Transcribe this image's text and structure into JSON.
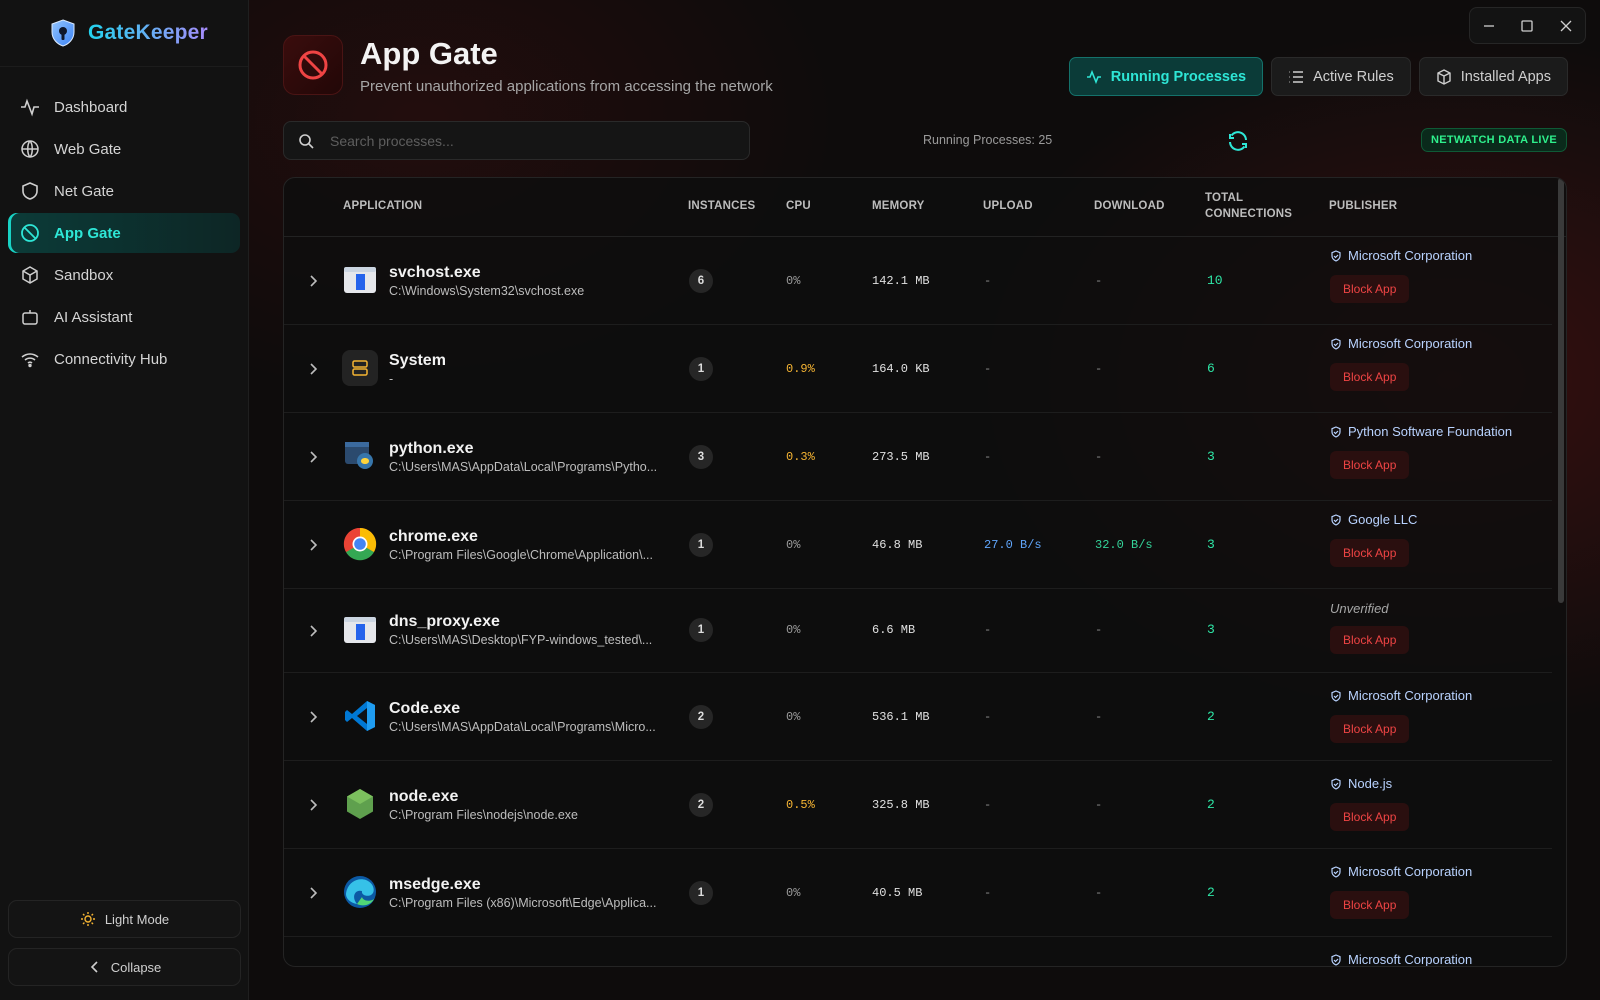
{
  "app": {
    "name": "GateKeeper"
  },
  "sidebar": {
    "items": [
      {
        "label": "Dashboard",
        "icon": "activity-icon"
      },
      {
        "label": "Web Gate",
        "icon": "globe-icon"
      },
      {
        "label": "Net Gate",
        "icon": "shield-icon"
      },
      {
        "label": "App Gate",
        "icon": "ban-icon",
        "active": true
      },
      {
        "label": "Sandbox",
        "icon": "box-icon"
      },
      {
        "label": "AI Assistant",
        "icon": "bot-icon"
      },
      {
        "label": "Connectivity Hub",
        "icon": "wifi-icon"
      }
    ],
    "light_mode_label": "Light Mode",
    "collapse_label": "Collapse"
  },
  "header": {
    "title": "App Gate",
    "subtitle": "Prevent unauthorized applications from accessing the network",
    "tabs": [
      {
        "label": "Running Processes",
        "active": true
      },
      {
        "label": "Active Rules"
      },
      {
        "label": "Installed Apps"
      }
    ]
  },
  "toolbar": {
    "search_placeholder": "Search processes...",
    "process_count": "Running Processes: 25",
    "live_badge": "NETWATCH DATA LIVE"
  },
  "table": {
    "columns": [
      "APPLICATION",
      "INSTANCES",
      "CPU",
      "MEMORY",
      "UPLOAD",
      "DOWNLOAD",
      "TOTAL",
      "CONNECTIONS",
      "PUBLISHER"
    ],
    "block_label": "Block App",
    "rows": [
      {
        "name": "svchost.exe",
        "path": "C:\\Windows\\System32\\svchost.exe",
        "instances": "6",
        "cpu": "0%",
        "memory": "142.1 MB",
        "upload": "-",
        "download": "-",
        "connections": "10",
        "publisher": "Microsoft Corporation",
        "icon": "windows-app-icon"
      },
      {
        "name": "System",
        "path": "-",
        "instances": "1",
        "cpu": "0.9%",
        "memory": "164.0 KB",
        "upload": "-",
        "download": "-",
        "connections": "6",
        "publisher": "Microsoft Corporation",
        "icon": "server-icon"
      },
      {
        "name": "python.exe",
        "path": "C:\\Users\\MAS\\AppData\\Local\\Programs\\Pytho...",
        "instances": "3",
        "cpu": "0.3%",
        "memory": "273.5 MB",
        "upload": "-",
        "download": "-",
        "connections": "3",
        "publisher": "Python Software Foundation",
        "icon": "python-icon"
      },
      {
        "name": "chrome.exe",
        "path": "C:\\Program Files\\Google\\Chrome\\Application\\...",
        "instances": "1",
        "cpu": "0%",
        "memory": "46.8 MB",
        "upload": "27.0 B/s",
        "download": "32.0 B/s",
        "connections": "3",
        "publisher": "Google LLC",
        "icon": "chrome-icon"
      },
      {
        "name": "dns_proxy.exe",
        "path": "C:\\Users\\MAS\\Desktop\\FYP-windows_tested\\...",
        "instances": "1",
        "cpu": "0%",
        "memory": "6.6 MB",
        "upload": "-",
        "download": "-",
        "connections": "3",
        "publisher": "Unverified",
        "icon": "windows-app-icon"
      },
      {
        "name": "Code.exe",
        "path": "C:\\Users\\MAS\\AppData\\Local\\Programs\\Micro...",
        "instances": "2",
        "cpu": "0%",
        "memory": "536.1 MB",
        "upload": "-",
        "download": "-",
        "connections": "2",
        "publisher": "Microsoft Corporation",
        "icon": "vscode-icon"
      },
      {
        "name": "node.exe",
        "path": "C:\\Program Files\\nodejs\\node.exe",
        "instances": "2",
        "cpu": "0.5%",
        "memory": "325.8 MB",
        "upload": "-",
        "download": "-",
        "connections": "2",
        "publisher": "Node.js",
        "icon": "nodejs-icon"
      },
      {
        "name": "msedge.exe",
        "path": "C:\\Program Files (x86)\\Microsoft\\Edge\\Applica...",
        "instances": "1",
        "cpu": "0%",
        "memory": "40.5 MB",
        "upload": "-",
        "download": "-",
        "connections": "2",
        "publisher": "Microsoft Corporation",
        "icon": "edge-icon"
      }
    ],
    "partial_row_publisher": "Microsoft Corporation"
  },
  "colors": {
    "accent": "#2ee6d6",
    "danger": "#ef4444",
    "warn": "#f5b433",
    "live": "#2ef08c"
  }
}
